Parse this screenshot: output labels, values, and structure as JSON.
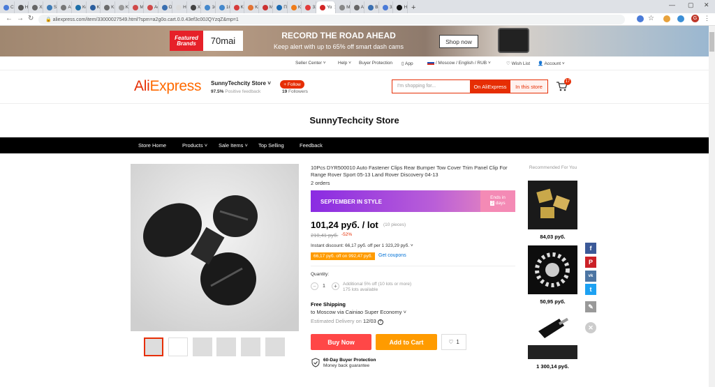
{
  "browser": {
    "tabs": [
      "Co",
      "He",
      "Xp",
      "SM",
      "A r",
      "Ko",
      "Ko",
      "Kp",
      "Ko",
      "Mc",
      "Ae",
      "От",
      "Но",
      "Xo",
      "1C",
      "1C",
      "Ka",
      "Ka",
      "МТ",
      "Пр",
      "Ka",
      "33",
      "Yo",
      "My",
      "All",
      "BM",
      "33",
      "Ho"
    ],
    "active_tab_index": 22,
    "new_tab": "+",
    "url": "aliexpress.com/item/33000027549.html?spm=a2g0o.cart.0.0.43ef3c00JQYzqZ&mp=1",
    "profile_initial": "G"
  },
  "banner": {
    "badge_top": "Featured",
    "badge_bottom": "Brands",
    "brand": "70mai",
    "headline": "RECORD THE ROAD AHEAD",
    "subline": "Keep alert with up to 65% off smart dash cams",
    "cta": "Shop now"
  },
  "util": {
    "seller_center": "Seller Center",
    "help": "Help",
    "buyer_protection": "Buyer Protection",
    "app": "App",
    "locale": "/ Moscow / English / RUB",
    "wish_list": "Wish List",
    "account": "Account"
  },
  "header": {
    "logo_a": "Ali",
    "logo_b": "Express",
    "store_name": "SunnyTechcity Store",
    "feedback_pct": "97.5%",
    "feedback_label": "Positive feedback",
    "follow": "+ Follow",
    "followers_count": "19",
    "followers_label": "Followers",
    "search_placeholder": "I'm shopping for...",
    "search_ali": "On AliExpress",
    "search_store": "In this store",
    "cart_count": "17"
  },
  "store_title": "SunnyTechcity Store",
  "nav": [
    "Store Home",
    "Products",
    "Sale Items",
    "Top Selling",
    "Feedback"
  ],
  "product": {
    "title": "10Pcs DYR500010 Auto Fastener Clips Rear Bumper Tow Cover Trim Panel Clip For Range Rover Sport 05-13 Land Rover Discovery 04-13",
    "orders": "2 orders",
    "promo": "SEPTEMBER IN STYLE",
    "ends_label": "Ends in",
    "ends_value": "2",
    "ends_unit": "days",
    "price": "101,24 руб. / lot",
    "pieces": "(10 pieces)",
    "old_price": "210,41 руб.",
    "discount": "-52%",
    "instant": "Instant discount: 66,17 руб. off per 1 323,29 руб.",
    "coupon": "66,17 руб. off on 992,47 руб.",
    "get_coupons": "Get coupons",
    "quantity_label": "Quantity:",
    "quantity": "1",
    "additional": "Additional 5% off (10 lots or more)",
    "lots_available": "175 lots available",
    "free_shipping": "Free Shipping",
    "ship_to": "to Moscow via Cainiao Super Economy",
    "est_label": "Estimated Delivery on",
    "est_date": "12/03",
    "buy_now": "Buy Now",
    "add_cart": "Add to Cart",
    "wish_count": "1",
    "protection_title": "60-Day Buyer Protection",
    "protection_sub": "Money back guarantee"
  },
  "recommended": {
    "title": "Recommended For You",
    "prices": [
      "84,03 руб.",
      "50,95 руб.",
      "1 300,14 руб."
    ]
  },
  "social": [
    "f",
    "P",
    "vk",
    "t"
  ]
}
